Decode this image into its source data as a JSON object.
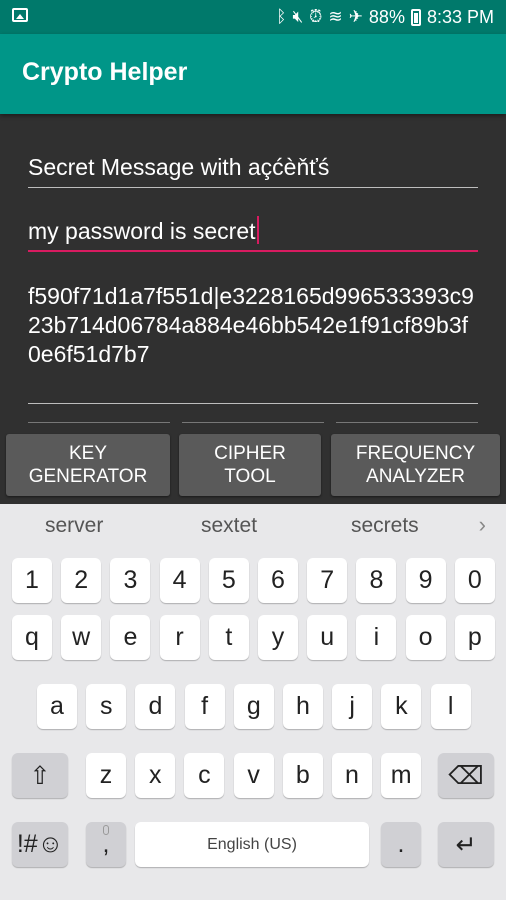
{
  "status": {
    "battery_pct": "88%",
    "time": "8:33 PM",
    "icons": [
      "gallery-icon",
      "bluetooth-icon",
      "mute-icon",
      "alarm-icon",
      "wifi-icon",
      "airplane-icon",
      "battery-icon"
    ]
  },
  "app": {
    "title": "Crypto Helper",
    "accent": "#009688",
    "status_color": "#00796b"
  },
  "fields": {
    "message": "Secret Message with açćèňťś",
    "password": "my password is secret",
    "output": "f590f71d1a7f551d|e3228165d996533393c923b714d06784a884e46bb542e1f91cf89b3f0e6f51d7b7"
  },
  "buttons": {
    "key_generator": "KEY\nGENERATOR",
    "cipher_tool": "CIPHER\nTOOL",
    "frequency_analyzer": "FREQUENCY\nANALYZER"
  },
  "keyboard": {
    "suggestions": [
      "server",
      "sextet",
      "secrets"
    ],
    "row_numbers": [
      "1",
      "2",
      "3",
      "4",
      "5",
      "6",
      "7",
      "8",
      "9",
      "0"
    ],
    "row_top": [
      "q",
      "w",
      "e",
      "r",
      "t",
      "y",
      "u",
      "i",
      "o",
      "p"
    ],
    "row_mid": [
      "a",
      "s",
      "d",
      "f",
      "g",
      "h",
      "j",
      "k",
      "l"
    ],
    "row_bottom": [
      "z",
      "x",
      "c",
      "v",
      "b",
      "n",
      "m"
    ],
    "symbols": "!#☺",
    "comma": ",",
    "space": "English (US)",
    "period": ".",
    "shift_glyph": "⇧",
    "backspace_glyph": "⌫",
    "enter_glyph": "↵"
  }
}
